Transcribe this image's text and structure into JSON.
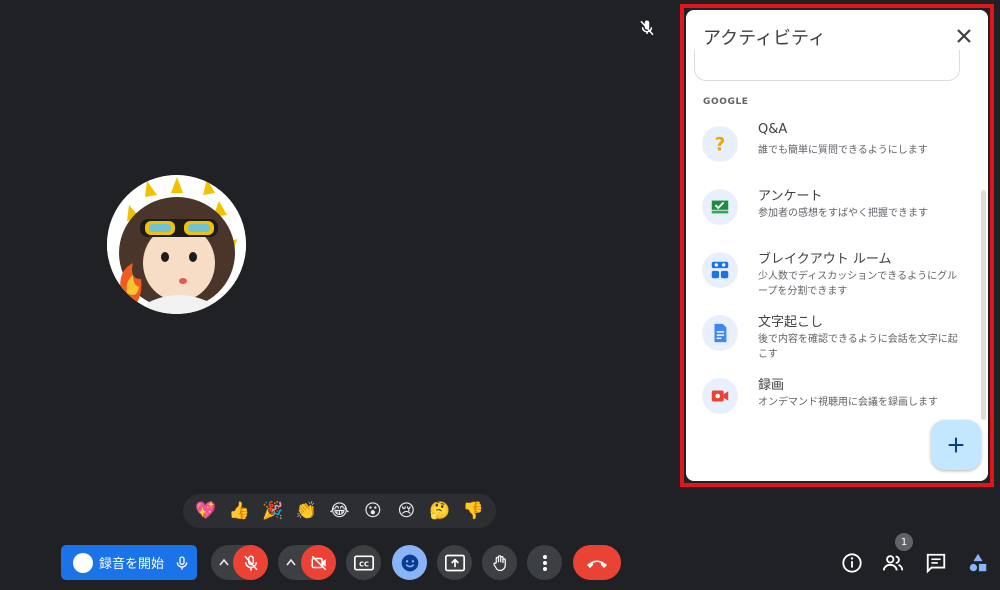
{
  "panel": {
    "title": "アクティビティ",
    "section_label": "GOOGLE",
    "items": [
      {
        "title": "Q&A",
        "desc": "誰でも簡単に質問できるようにします",
        "icon": "qa-icon"
      },
      {
        "title": "アンケート",
        "desc": "参加者の感想をすばやく把握できます",
        "icon": "poll-icon"
      },
      {
        "title": "ブレイクアウト ルーム",
        "desc": "少人数でディスカッションできるようにグループを分割できます",
        "icon": "breakout-rooms-icon"
      },
      {
        "title": "文字起こし",
        "desc": "後で内容を確認できるように会話を文字に起こす",
        "icon": "transcript-icon"
      },
      {
        "title": "録画",
        "desc": "オンデマンド視聴用に会議を録画します",
        "icon": "recording-icon"
      }
    ]
  },
  "reactions": [
    "💖",
    "👍",
    "🎉",
    "👏",
    "😂",
    "😮",
    "😢",
    "🤔",
    "👎"
  ],
  "controls": {
    "record_label": "録音を開始"
  },
  "participants_count": "1",
  "colors": {
    "background": "#202124",
    "accent_blue": "#1a73e8",
    "danger_red": "#ea4335",
    "panel_outline": "#e0161c"
  }
}
